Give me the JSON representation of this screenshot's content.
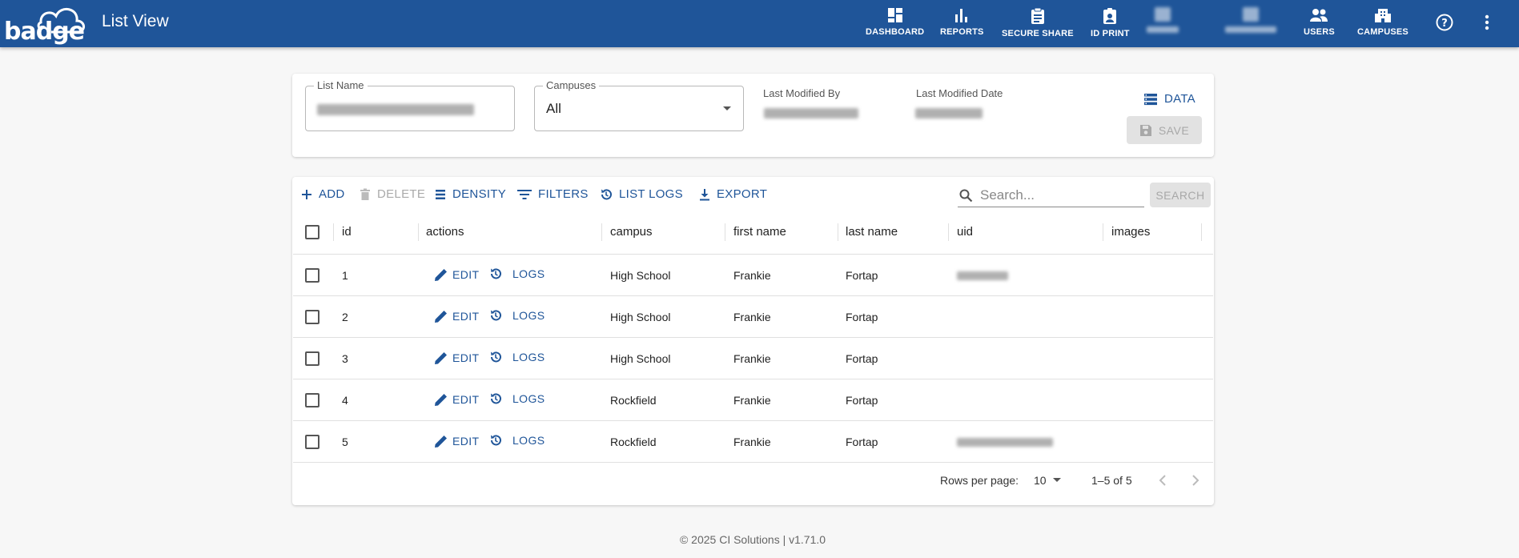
{
  "app": {
    "logo_text": "badge",
    "title": "List View"
  },
  "nav": {
    "dashboard": "DASHBOARD",
    "reports": "REPORTS",
    "secure_share": "SECURE SHARE",
    "id_print": "ID PRINT",
    "users": "USERS",
    "campuses": "CAMPUSES"
  },
  "form": {
    "list_name_label": "List Name",
    "campuses_label": "Campuses",
    "campuses_value": "All",
    "last_modified_by_label": "Last Modified By",
    "last_modified_date_label": "Last Modified Date",
    "data_label": "DATA",
    "save_label": "SAVE"
  },
  "toolbar": {
    "add": "ADD",
    "delete": "DELETE",
    "density": "DENSITY",
    "filters": "FILTERS",
    "list_logs": "LIST LOGS",
    "export": "EXPORT",
    "search_placeholder": "Search...",
    "search_button": "SEARCH"
  },
  "grid": {
    "columns": [
      "id",
      "actions",
      "campus",
      "first name",
      "last name",
      "uid",
      "images"
    ],
    "edit_label": "EDIT",
    "logs_label": "LOGS",
    "rows": [
      {
        "id": "1",
        "campus": "High School",
        "first_name": "Frankie",
        "last_name": "Fortap"
      },
      {
        "id": "2",
        "campus": "High School",
        "first_name": "Frankie",
        "last_name": "Fortap"
      },
      {
        "id": "3",
        "campus": "High School",
        "first_name": "Frankie",
        "last_name": "Fortap"
      },
      {
        "id": "4",
        "campus": "Rockfield",
        "first_name": "Frankie",
        "last_name": "Fortap"
      },
      {
        "id": "5",
        "campus": "Rockfield",
        "first_name": "Frankie",
        "last_name": "Fortap"
      }
    ]
  },
  "pagination": {
    "rows_per_page_label": "Rows per page:",
    "rows_per_page": "10",
    "range": "1–5 of 5"
  },
  "footer": {
    "copyright": "© 2025 CI Solutions | v1.71.0"
  },
  "colors": {
    "primary": "#1f5599",
    "disabled": "#aaaaaa"
  }
}
